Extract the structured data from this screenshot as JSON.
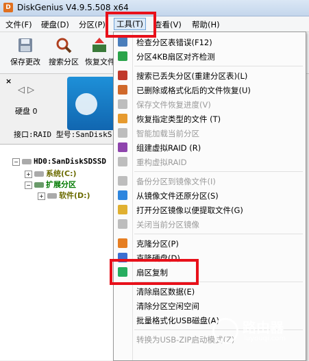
{
  "window": {
    "title": "DiskGenius V4.9.5.508 x64",
    "logo_glyph": "D"
  },
  "menubar": [
    {
      "label": "文件(F)"
    },
    {
      "label": "硬盘(D)"
    },
    {
      "label": "分区(P)"
    },
    {
      "label": "工具(T)"
    },
    {
      "label": "查看(V)"
    },
    {
      "label": "帮助(H)"
    }
  ],
  "toolbar": [
    {
      "label": "保存更改",
      "icon": "save-icon"
    },
    {
      "label": "搜索分区",
      "icon": "magnifier-icon"
    },
    {
      "label": "恢复文件",
      "icon": "recover-icon"
    }
  ],
  "left_panel": {
    "close_glyph": "×",
    "nav_glyph": "◁ ▷",
    "disk_label": "硬盘 0",
    "info": "接口:RAID  型号:SanDiskS"
  },
  "tree": {
    "disk": "HD0:SanDiskSDSSD",
    "system": "系统(C:)",
    "extended": "扩展分区",
    "software": "软件(D:)",
    "plus": "+",
    "minus": "−"
  },
  "tools_menu": [
    {
      "label": "检查分区表错误(F12)",
      "disabled": false,
      "icon_color": "#4a7ebb"
    },
    {
      "label": "分区4KB扇区对齐检测",
      "disabled": false,
      "icon_color": "#2aa44a"
    },
    {
      "sep": true
    },
    {
      "label": "搜索已丢失分区(重建分区表)(L)",
      "disabled": false,
      "icon_color": "#c0392b"
    },
    {
      "label": "已删除或格式化后的文件恢复(U)",
      "disabled": false,
      "icon_color": "#d0692b"
    },
    {
      "label": "保存文件恢复进度(V)",
      "disabled": true,
      "icon_color": "#bdbdbd"
    },
    {
      "label": "恢复指定类型的文件 (T)",
      "disabled": false,
      "icon_color": "#e69a2e"
    },
    {
      "label": "智能加载当前分区",
      "disabled": true,
      "icon_color": "#bdbdbd"
    },
    {
      "label": "组建虚拟RAID (R)",
      "disabled": false,
      "icon_color": "#8e44ad"
    },
    {
      "label": "重构虚拟RAID",
      "disabled": true,
      "icon_color": "#bdbdbd"
    },
    {
      "sep": true
    },
    {
      "label": "备份分区到镜像文件(I)",
      "disabled": true,
      "icon_color": "#bdbdbd"
    },
    {
      "label": "从镜像文件还原分区(S)",
      "disabled": false,
      "icon_color": "#2e86de"
    },
    {
      "label": "打开分区镜像以便提取文件(G)",
      "disabled": false,
      "icon_color": "#e0b030"
    },
    {
      "label": "关闭当前分区镜像",
      "disabled": true,
      "icon_color": "#bdbdbd"
    },
    {
      "sep": true
    },
    {
      "label": "克隆分区(P)",
      "disabled": false,
      "icon_color": "#e67e22"
    },
    {
      "label": "克隆硬盘(D)",
      "disabled": false,
      "icon_color": "#3b6fd1"
    },
    {
      "label": "扇区复制",
      "disabled": false,
      "icon_color": "#27ae60"
    },
    {
      "sep": true
    },
    {
      "label": "清除扇区数据(E)",
      "disabled": false,
      "icon_color": ""
    },
    {
      "label": "清除分区空闲空间",
      "disabled": false,
      "icon_color": ""
    },
    {
      "label": "批量格式化USB磁盘(A)",
      "disabled": false,
      "icon_color": ""
    },
    {
      "sep": true
    },
    {
      "label": "转换为USB-ZIP启动模式(Z)",
      "disabled": true,
      "icon_color": ""
    }
  ],
  "watermark": {
    "text": "路由器",
    "sub": "luyouqi.com"
  },
  "colors": {
    "highlight_red": "#e8101a",
    "accent_blue": "#1e90d8"
  }
}
